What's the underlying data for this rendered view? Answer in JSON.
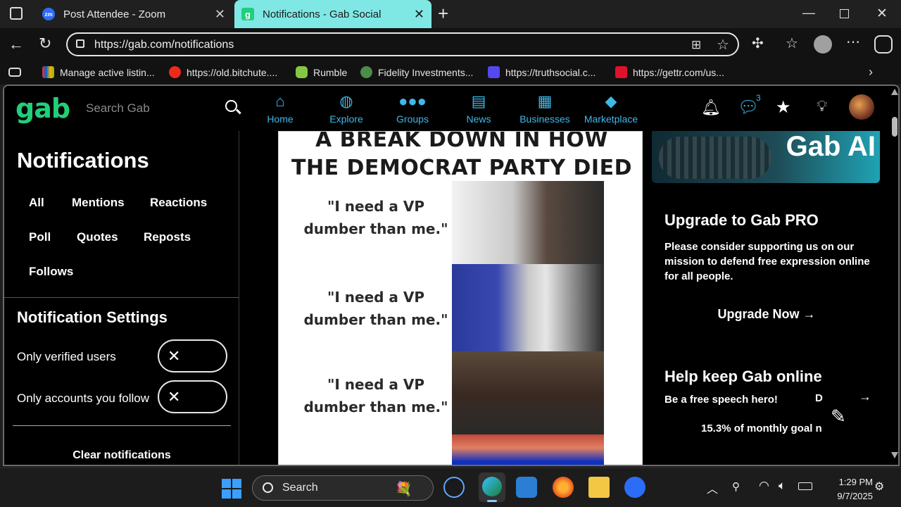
{
  "browser": {
    "tabs": [
      {
        "title": "Post Attendee - Zoom",
        "favicon": "zoom-icon",
        "active": false
      },
      {
        "title": "Notifications - Gab Social",
        "favicon": "gab-icon",
        "active": true
      }
    ],
    "new_tab_label": "+",
    "url": "https://gab.com/notifications",
    "bookmarks": [
      {
        "label": "Manage active listin...",
        "icon": "ebay-icon"
      },
      {
        "label": "https://old.bitchute....",
        "icon": "bitchute-icon"
      },
      {
        "label": "Rumble",
        "icon": "rumble-icon"
      },
      {
        "label": "Fidelity Investments...",
        "icon": "fidelity-icon"
      },
      {
        "label": "https://truthsocial.c...",
        "icon": "truthsocial-icon"
      },
      {
        "label": "https://gettr.com/us...",
        "icon": "gettr-icon"
      }
    ]
  },
  "gab": {
    "logo": "gab",
    "search_placeholder": "Search Gab",
    "nav": [
      {
        "label": "Home",
        "icon": "home-icon"
      },
      {
        "label": "Explore",
        "icon": "globe-icon"
      },
      {
        "label": "Groups",
        "icon": "groups-icon"
      },
      {
        "label": "News",
        "icon": "news-icon"
      },
      {
        "label": "Businesses",
        "icon": "grid-icon"
      },
      {
        "label": "Marketplace",
        "icon": "tag-icon"
      }
    ],
    "chat_badge": "3",
    "notifications_title": "Notifications",
    "filters": [
      "All",
      "Mentions",
      "Reactions",
      "Poll",
      "Quotes",
      "Reposts",
      "Follows"
    ],
    "settings": {
      "title": "Notification Settings",
      "items": [
        {
          "label": "Only verified users"
        },
        {
          "label": "Only accounts you follow"
        }
      ]
    },
    "clear_label": "Clear notifications",
    "post": {
      "headline_1": "A BREAK DOWN IN HOW",
      "headline_2": "THE DEMOCRAT PARTY DIED",
      "captions": [
        {
          "line1": "\"I need a VP",
          "line2": "dumber than me.\""
        },
        {
          "line1": "\"I need a VP",
          "line2": "dumber than me.\""
        },
        {
          "line1": "\"I need a VP",
          "line2": "dumber than me.\""
        }
      ]
    },
    "sidebar": {
      "banner_text": "Gab AI",
      "pro_title": "Upgrade to Gab PRO",
      "pro_body": "Please consider supporting us on our mission to defend free expression online for all people.",
      "upgrade_label": "Upgrade Now →",
      "help_title": "Help keep Gab online",
      "help_sub": "Be a free speech hero!",
      "help_cut": "D",
      "goal_text": "15.3% of monthly goal n"
    }
  },
  "taskbar": {
    "search_label": "Search",
    "time": "1:29 PM",
    "date": "9/7/2025"
  },
  "colors": {
    "gab_green": "#21cf7a",
    "nav_blue": "#3fb8e9",
    "active_tab": "#7fe8e5"
  }
}
